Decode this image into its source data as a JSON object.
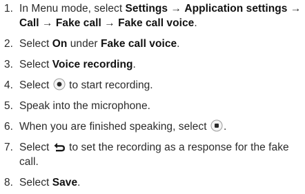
{
  "steps": [
    {
      "num": "1.",
      "parts": {
        "a": "In Menu mode, select ",
        "b": "Settings",
        "c": " → ",
        "d": "Application settings",
        "e": " → ",
        "f": "Call",
        "g": " → ",
        "h": "Fake call",
        "i": " → ",
        "j": "Fake call voice",
        "k": "."
      }
    },
    {
      "num": "2.",
      "parts": {
        "a": "Select ",
        "b": "On",
        "c": " under ",
        "d": "Fake call voice",
        "e": "."
      }
    },
    {
      "num": "3.",
      "parts": {
        "a": "Select ",
        "b": "Voice recording",
        "c": "."
      }
    },
    {
      "num": "4.",
      "parts": {
        "a": "Select ",
        "icon": "record-icon",
        "b": " to start recording."
      }
    },
    {
      "num": "5.",
      "parts": {
        "a": "Speak into the microphone."
      }
    },
    {
      "num": "6.",
      "parts": {
        "a": "When you are finished speaking, select ",
        "icon": "stop-icon",
        "b": "."
      }
    },
    {
      "num": "7.",
      "parts": {
        "a": "Select ",
        "icon": "back-arrow-icon",
        "b": " to set the recording as a response for the fake call."
      }
    },
    {
      "num": "8.",
      "parts": {
        "a": "Select ",
        "b": "Save",
        "c": "."
      }
    }
  ]
}
